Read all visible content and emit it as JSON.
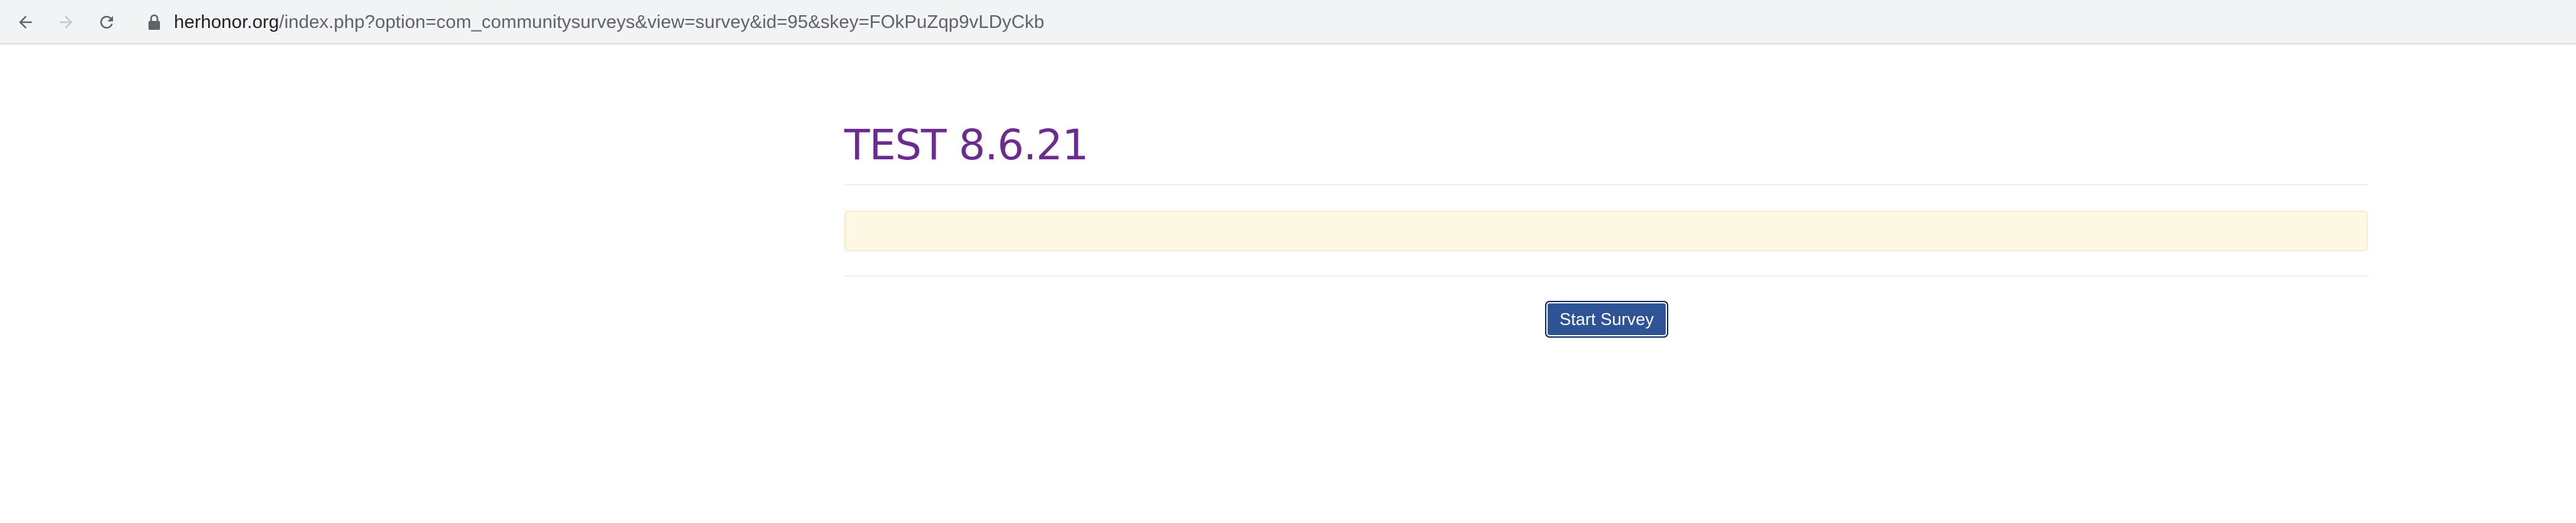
{
  "browser": {
    "back_icon": "arrow-left-icon",
    "forward_icon": "arrow-right-icon",
    "reload_icon": "reload-icon",
    "lock_icon": "lock-icon",
    "url_domain": "herhonor.org",
    "url_path": "/index.php?option=com_communitysurveys&view=survey&id=95&skey=FOkPuZqp9vLDyCkb"
  },
  "page": {
    "title": "TEST 8.6.21",
    "notice_text": "",
    "start_button_label": "Start Survey"
  },
  "colors": {
    "title": "#6a2c91",
    "notice_background": "#fcf8e3",
    "button_background": "#2f5496"
  }
}
